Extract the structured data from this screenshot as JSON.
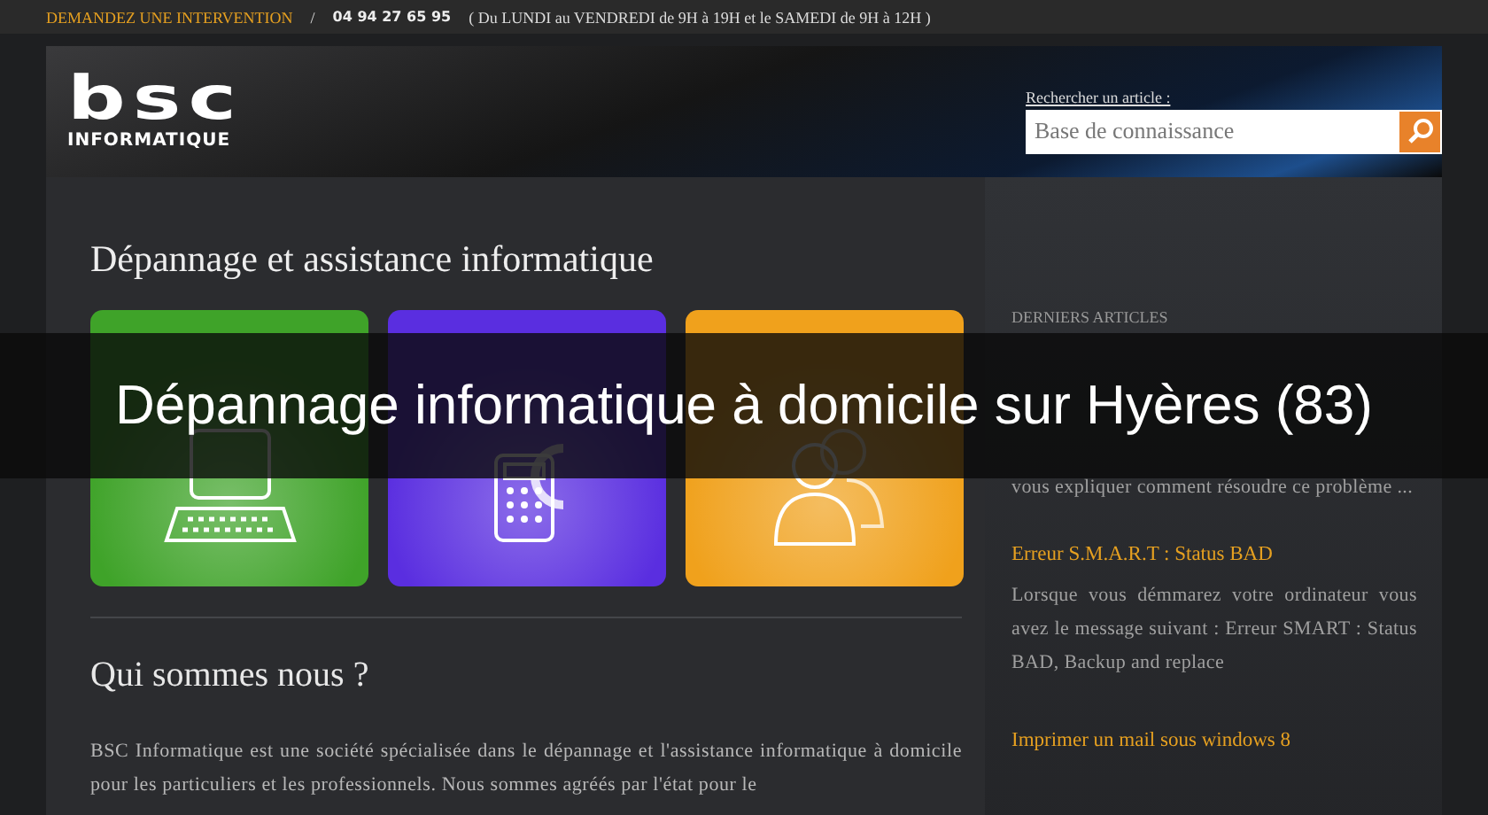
{
  "top_bar": {
    "cta": "DEMANDEZ UNE INTERVENTION",
    "separator": "/",
    "phone": "04 94 27 65 95",
    "hours": "(   Du LUNDI au VENDREDI de 9H à 19H et le SAMEDI de 9H à 12H   )"
  },
  "header": {
    "logo_mark": "bsc",
    "logo_text": "INFORMATIQUE",
    "search_label": "Rechercher un article :",
    "search": {
      "placeholder": "Base de connaissance"
    }
  },
  "main": {
    "title": "Dépannage et assistance informatique",
    "cards": [
      {
        "kind": "computer",
        "color": "#3fa329"
      },
      {
        "kind": "calculator",
        "color": "#5a2ee0"
      },
      {
        "kind": "people",
        "color": "#f0a11c"
      }
    ],
    "about_title": "Qui sommes nous ?",
    "about_text": "BSC Informatique est une société spécialisée dans le dépannage et l'assistance informatique à domicile pour les particuliers et les professionnels. Nous sommes agréés par l'état pour le"
  },
  "sidebar": {
    "heading": "DERNIERS ARTICLES",
    "articles": [
      {
        "text": "vous expliquer comment résoudre ce problème ..."
      },
      {
        "title": "Erreur S.M.A.R.T : Status BAD",
        "text": "Lorsque vous démmarez votre ordinateur vous avez le message suivant : Erreur SMART : Status BAD, Backup and replace"
      },
      {
        "title": "Imprimer un mail sous windows 8"
      }
    ]
  },
  "banner": {
    "text": "Dépannage informatique à domicile sur Hyères (83)"
  }
}
